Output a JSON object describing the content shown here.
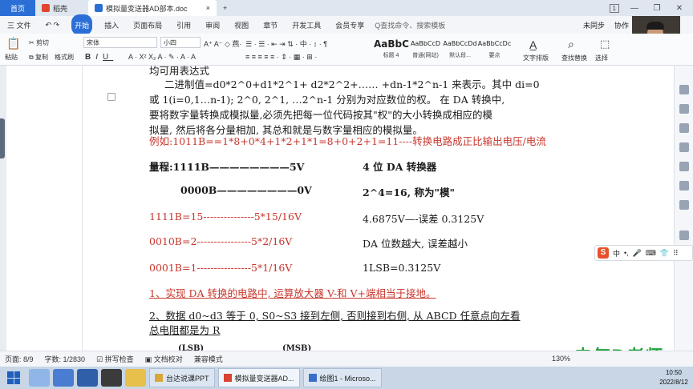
{
  "titlebar": {
    "tabs": [
      {
        "label": "首页"
      },
      {
        "label": "稻壳"
      },
      {
        "label": "模拟量变送器AD部本.doc"
      }
    ],
    "new_tab": "+",
    "right": {
      "box": "1"
    }
  },
  "menu": {
    "file": "三 文件",
    "items": [
      "开始",
      "插入",
      "页面布局",
      "引用",
      "审阅",
      "视图",
      "章节",
      "开发工具",
      "会员专享"
    ],
    "search": "Q查找命令、搜索模板",
    "sync": "未同步",
    "coop": "协作"
  },
  "toolbar": {
    "cut": "剪切",
    "copy": "复制",
    "paste": "粘贴",
    "format_painter": "格式刷",
    "font_name": "宋体",
    "font_size": "小四",
    "styles": [
      {
        "sample": "AaBbC",
        "label": "标题 4"
      },
      {
        "sample": "AaBbCcD",
        "label": "普通(网站)"
      },
      {
        "sample": "AaBbCcDd",
        "label": "默认段..."
      },
      {
        "sample": "AaBbCcDc",
        "label": "要点"
      }
    ],
    "text_layout": "文字排版",
    "find_replace": "查找替换",
    "select": "选择"
  },
  "document": {
    "lines": [
      "均可用表达式",
      "二进制值=d0*2^0+d1*2^1+ d2*2^2+…… +dn-1*2^n-1 来表示。其中 di=0",
      "或 1(i=0,1…n-1); 2^0, 2^1, …2^n-1 分别为对应数位的权。 在 DA 转换中,",
      "要将数字量转换成模拟量,必须先把每一位代码按其\"权\"的大小转换成相应的模",
      "拟量, 然后将各分量相加, 其总和就是与数字量相应的模拟量。",
      "例如:1011B==1*8+0*4+1*2+1*1=8+0+2+1=11----转换电路成正比输出电压/电流",
      "量程:1111B————————5V",
      "4 位 DA 转换器",
      "0000B————————0V",
      "2^4=16, 称为\"模\"",
      "1111B=15---------------5*15/16V",
      "4.6875V—-误差 0.3125V",
      "0010B=2----------------5*2/16V",
      "DA 位数越大, 误差越小",
      "0001B=1----------------5*1/16V",
      "1LSB=0.3125V",
      "1、实现 DA 转换的电路中, 运算放大器 V-和 V+端相当于接地。",
      "2、数据 d0~d3 等于 0, S0~S3 接到左侧, 否则接到右侧, 从 ABCD 任意点向左看",
      "总电阻都是为 R",
      "(LSB)",
      "(MSB)"
    ]
  },
  "statusbar": {
    "page": "页面: 8/9",
    "words": "字数: 1/2830",
    "spell": "拼写检查",
    "proof": "文档校对",
    "compat": "兼容模式",
    "zoom": "130%"
  },
  "ime": {
    "lang": "中"
  },
  "watermark": "电气D老师",
  "taskbar": {
    "windows": [
      "台达说课PPT",
      "模拟量变送器AD...",
      "绘图1 - Microso..."
    ],
    "time": "10:50",
    "date": "2022/8/12"
  }
}
